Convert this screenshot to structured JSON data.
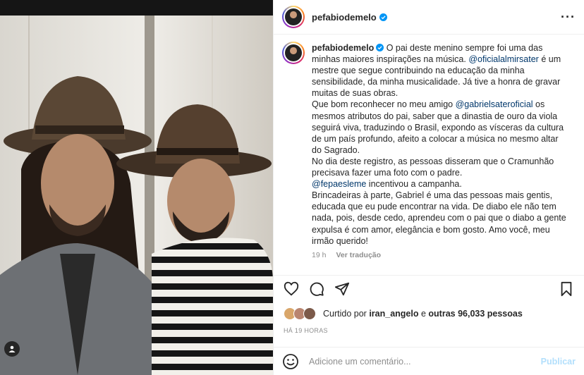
{
  "post": {
    "username": "pefabiodemelo",
    "verified_icon": "verified-badge-icon",
    "more_icon": "more-options-icon"
  },
  "caption": {
    "username": "pefabiodemelo",
    "part1": " O pai deste menino sempre foi uma das minhas maiores inspirações na música. ",
    "mention1": "@oficialalmirsater",
    "part2": " é um mestre que segue contribuindo na educação da minha sensibilidade, da minha musicalidade. Já tive a honra de gravar muitas de suas obras.\nQue bom reconhecer no meu amigo ",
    "mention2": "@gabrielsateroficial",
    "part3": " os mesmos atributos do pai, saber que a dinastia de ouro da viola seguirá viva, traduzindo o Brasil, expondo as vísceras da cultura de um país profundo, afeito a colocar a música no mesmo altar do Sagrado.\nNo dia deste registro, as pessoas disseram que o Cramunhão precisava fazer uma foto com o padre.\n",
    "mention3": "@fepaesleme",
    "part4": " incentivou a campanha.\nBrincadeiras à parte, Gabriel é uma das pessoas mais gentis, educada que eu pude encontrar na vida. De diabo ele não tem nada, pois, desde cedo, aprendeu com o pai que o diabo a gente expulsa é com amor, elegância e bom gosto. Amo você, meu irmão querido!",
    "time": "19 h",
    "translate": "Ver tradução"
  },
  "likes": {
    "prefix": "Curtido por ",
    "user": "iran_angelo",
    "middle": " e ",
    "others": "outras 96,033 pessoas"
  },
  "timestamp": "HÁ 19 HORAS",
  "comment": {
    "placeholder": "Adicione um comentário...",
    "publish": "Publicar"
  },
  "colors": {
    "mention": "#00376b",
    "verified": "#0095f6",
    "publish_disabled": "#b2dffc",
    "secondary_text": "#8e8e8e"
  }
}
